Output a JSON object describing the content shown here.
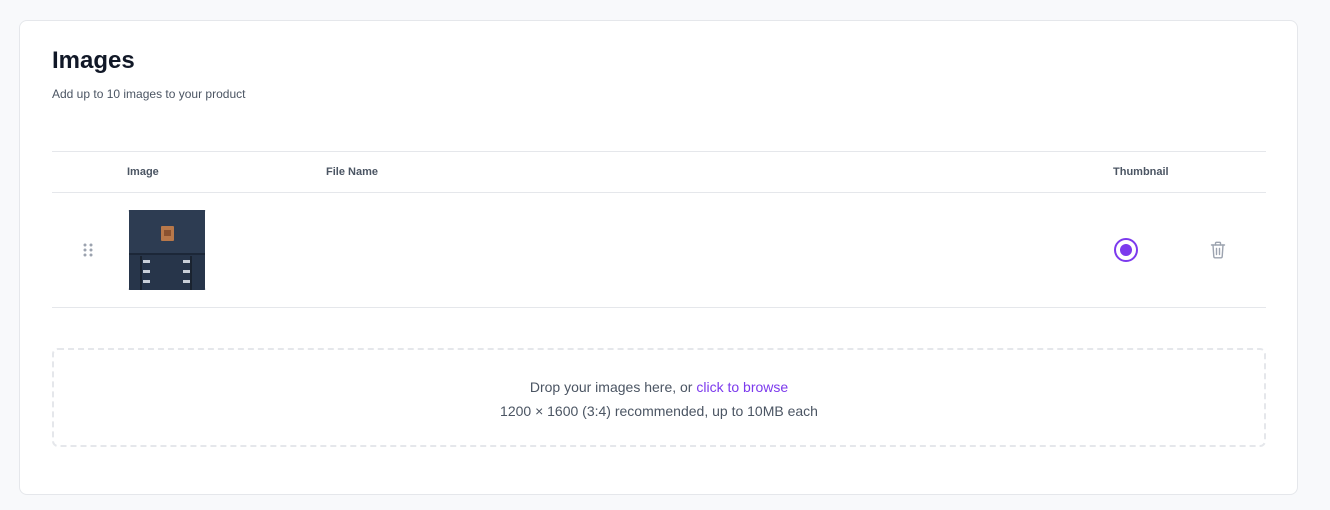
{
  "section": {
    "title": "Images",
    "subtitle": "Add up to 10 images to your product"
  },
  "table": {
    "columns": {
      "image": "Image",
      "file_name": "File Name",
      "thumbnail": "Thumbnail"
    },
    "rows": [
      {
        "image": "backpack-photo",
        "file_name": "",
        "is_thumbnail": true
      }
    ]
  },
  "dropzone": {
    "prefix": "Drop your images here, or ",
    "link": "click to browse",
    "hint": "1200 × 1600 (3:4) recommended, up to 10MB each"
  },
  "colors": {
    "accent": "#7c3aed",
    "text_muted": "#4b5563",
    "border": "#e5e7eb"
  },
  "icons": [
    "drag-handle-icon",
    "trash-icon",
    "radio-selected-icon"
  ]
}
